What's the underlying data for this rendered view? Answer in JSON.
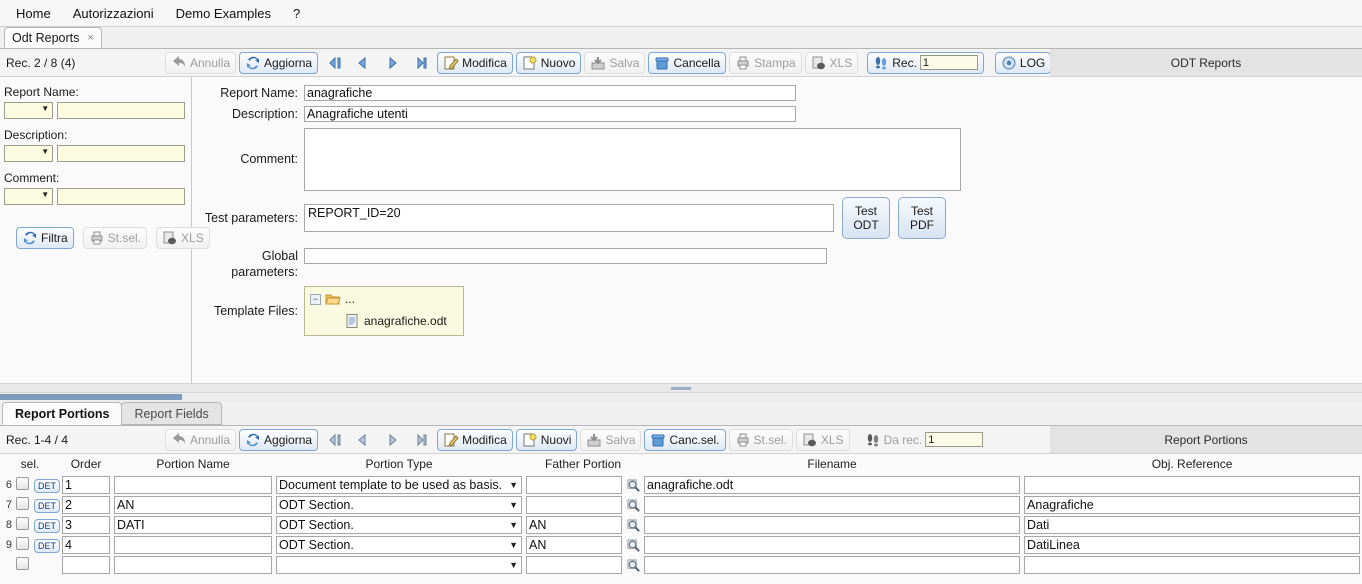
{
  "menubar": {
    "items": [
      {
        "label": "Home"
      },
      {
        "label": "Autorizzazioni"
      },
      {
        "label": "Demo Examples"
      },
      {
        "label": "?"
      }
    ]
  },
  "tabstrip": {
    "tab_label": "Odt Reports",
    "close_glyph": "×"
  },
  "top_toolbar": {
    "record_info": "Rec. 2 / 8 (4)",
    "panel_title": "ODT Reports",
    "buttons": [
      {
        "label": "Annulla",
        "icon": "undo-arrow-icon",
        "enabled": false
      },
      {
        "label": "Aggiorna",
        "icon": "refresh-icon",
        "enabled": true
      },
      {
        "label": "",
        "icon": "first-record-icon",
        "enabled": true
      },
      {
        "label": "",
        "icon": "prev-record-icon",
        "enabled": true
      },
      {
        "label": "",
        "icon": "next-record-icon",
        "enabled": true
      },
      {
        "label": "",
        "icon": "last-record-icon",
        "enabled": true
      },
      {
        "label": "Modifica",
        "icon": "edit-pencil-icon",
        "enabled": true
      },
      {
        "label": "Nuovo",
        "icon": "new-page-icon",
        "enabled": true
      },
      {
        "label": "Salva",
        "icon": "save-disk-icon",
        "enabled": false
      },
      {
        "label": "Cancella",
        "icon": "trash-can-icon",
        "enabled": true
      },
      {
        "label": "Stampa",
        "icon": "printer-icon",
        "enabled": false
      },
      {
        "label": "XLS",
        "icon": "xls-export-icon",
        "enabled": false
      }
    ],
    "rec_jump": {
      "label": "Rec.",
      "value": "1",
      "icon": "footsteps-icon"
    },
    "log_button": {
      "label": "LOG",
      "icon": "log-disc-icon"
    }
  },
  "filter_panel": {
    "fields": [
      {
        "label": "Report Name:",
        "operator": "",
        "value": ""
      },
      {
        "label": "Description:",
        "operator": "",
        "value": ""
      },
      {
        "label": "Comment:",
        "operator": "",
        "value": ""
      }
    ],
    "buttons": [
      {
        "label": "Filtra",
        "icon": "refresh-icon",
        "enabled": true
      },
      {
        "label": "St.sel.",
        "icon": "printer-icon",
        "enabled": false
      },
      {
        "label": "XLS",
        "icon": "xls-export-icon",
        "enabled": false
      }
    ]
  },
  "form": {
    "report_name": {
      "label": "Report Name:",
      "value": "anagrafiche"
    },
    "description": {
      "label": "Description:",
      "value": "Anagrafiche utenti"
    },
    "comment": {
      "label": "Comment:",
      "value": ""
    },
    "test_parameters": {
      "label": "Test parameters:",
      "value": "REPORT_ID=20"
    },
    "global_parameters": {
      "label": "Global parameters:",
      "value": ""
    },
    "template_files": {
      "label": "Template Files:",
      "root_label": "...",
      "collapse_glyph": "−",
      "file_label": "anagrafiche.odt"
    },
    "test_odt_button": "Test\nODT",
    "test_odt_line1": "Test",
    "test_odt_line2": "ODT",
    "test_pdf_line1": "Test",
    "test_pdf_line2": "PDF"
  },
  "grid_tabs": [
    {
      "label": "Report Portions",
      "active": true
    },
    {
      "label": "Report Fields",
      "active": false
    }
  ],
  "grid_toolbar": {
    "record_info": "Rec. 1-4 / 4",
    "panel_title": "Report Portions",
    "buttons": [
      {
        "label": "Annulla",
        "icon": "undo-arrow-icon",
        "enabled": false
      },
      {
        "label": "Aggiorna",
        "icon": "refresh-icon",
        "enabled": true
      },
      {
        "label": "",
        "icon": "first-record-icon",
        "enabled": true
      },
      {
        "label": "",
        "icon": "prev-record-icon",
        "enabled": true
      },
      {
        "label": "",
        "icon": "next-record-icon",
        "enabled": true
      },
      {
        "label": "",
        "icon": "last-record-icon",
        "enabled": true
      },
      {
        "label": "Modifica",
        "icon": "edit-pencil-icon",
        "enabled": true
      },
      {
        "label": "Nuovi",
        "icon": "new-page-icon",
        "enabled": true
      },
      {
        "label": "Salva",
        "icon": "save-disk-icon",
        "enabled": false
      },
      {
        "label": "Canc.sel.",
        "icon": "trash-can-icon",
        "enabled": true
      },
      {
        "label": "St.sel.",
        "icon": "printer-icon",
        "enabled": false
      },
      {
        "label": "XLS",
        "icon": "xls-export-icon",
        "enabled": false
      }
    ],
    "rec_jump": {
      "label": "Da rec.",
      "value": "1",
      "icon": "footsteps-icon"
    }
  },
  "grid": {
    "columns": [
      "sel.",
      "Order",
      "Portion Name",
      "Portion Type",
      "Father Portion",
      "Filename",
      "Obj. Reference"
    ],
    "detail_button_label": "DET",
    "rows": [
      {
        "num": "6",
        "order": "1",
        "portion_name": "",
        "portion_type": "Document template to be used as basis.",
        "father_portion": "",
        "filename": "anagrafiche.odt",
        "obj_reference": ""
      },
      {
        "num": "7",
        "order": "2",
        "portion_name": "AN",
        "portion_type": "ODT Section.",
        "father_portion": "",
        "filename": "",
        "obj_reference": "Anagrafiche"
      },
      {
        "num": "8",
        "order": "3",
        "portion_name": "DATI",
        "portion_type": "ODT Section.",
        "father_portion": "AN",
        "filename": "",
        "obj_reference": "Dati"
      },
      {
        "num": "9",
        "order": "4",
        "portion_name": "",
        "portion_type": "ODT Section.",
        "father_portion": "AN",
        "filename": "",
        "obj_reference": "DatiLinea"
      },
      {
        "num": "",
        "order": "",
        "portion_name": "",
        "portion_type": "",
        "father_portion": "",
        "filename": "",
        "obj_reference": ""
      }
    ]
  },
  "colors": {
    "accent_blue": "#7fa7d4",
    "filter_field_bg": "#fbfbe0",
    "tree_bg": "#fafae0",
    "panel_title_bg": "#e3e3e3"
  }
}
